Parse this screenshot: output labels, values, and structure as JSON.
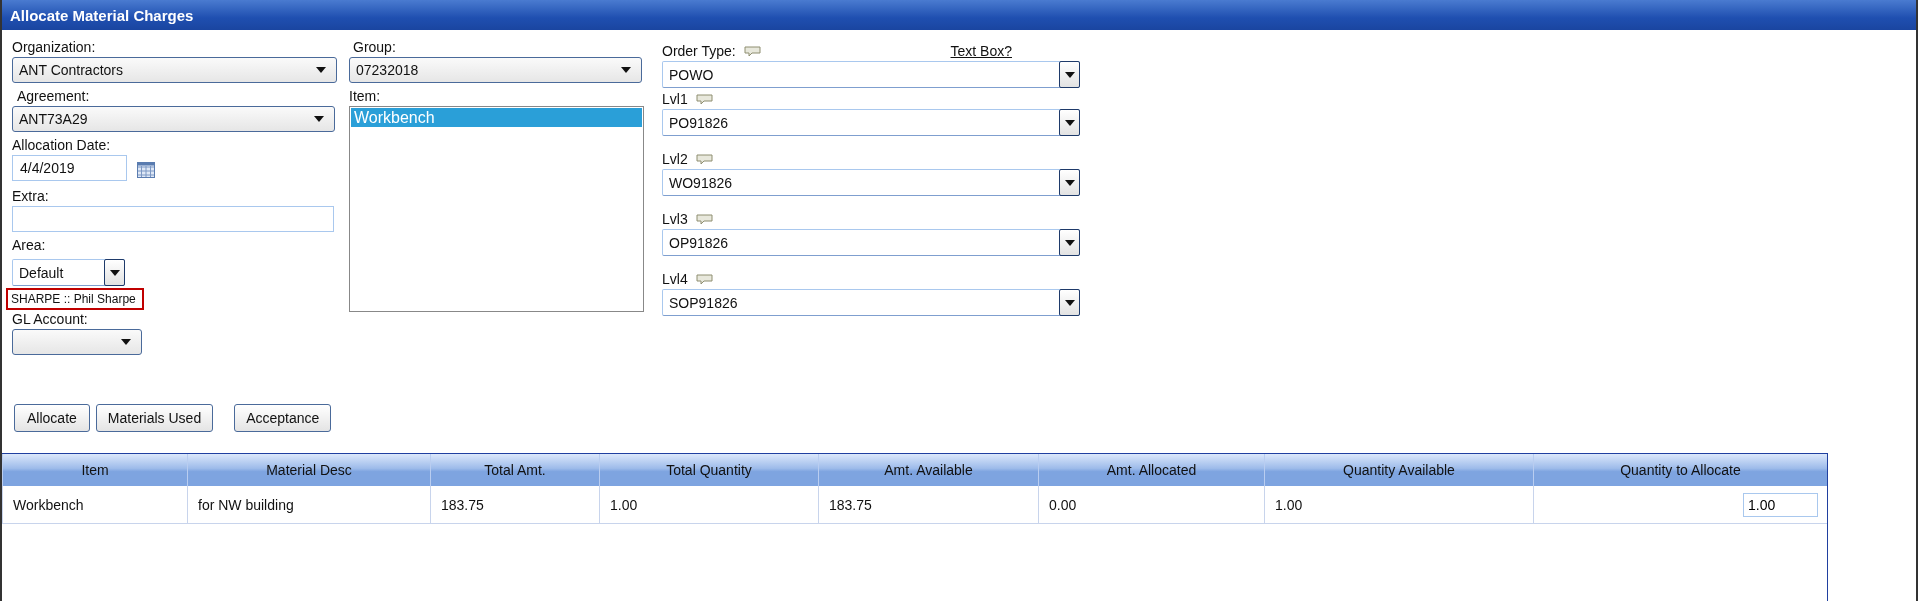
{
  "window": {
    "title": "Allocate Material Charges"
  },
  "organization": {
    "label": "Organization:",
    "value": "ANT Contractors"
  },
  "agreement": {
    "label": "Agreement:",
    "value": "ANT73A29"
  },
  "allocation_date": {
    "label": "Allocation Date:",
    "value": "4/4/2019"
  },
  "extra": {
    "label": "Extra:"
  },
  "area": {
    "label": "Area:",
    "value": "Default"
  },
  "owner_tag": "SHARPE :: Phil Sharpe",
  "gl_account": {
    "label": "GL Account:"
  },
  "group": {
    "label": "Group:",
    "value": "07232018"
  },
  "item": {
    "label": "Item:",
    "options": [
      {
        "label": "Workbench",
        "selected": true
      }
    ]
  },
  "order_type": {
    "label": "Order Type:",
    "value": "POWO"
  },
  "text_box_link": "Text Box?",
  "levels": [
    {
      "label": "Lvl1",
      "value": "PO91826"
    },
    {
      "label": "Lvl2",
      "value": "WO91826"
    },
    {
      "label": "Lvl3",
      "value": "OP91826"
    },
    {
      "label": "Lvl4",
      "value": "SOP91826"
    }
  ],
  "buttons": [
    "Allocate",
    "Materials Used",
    "Acceptance"
  ],
  "table": {
    "columns": [
      "Item",
      "Material Desc",
      "Total Amt.",
      "Total Quantity",
      "Amt. Available",
      "Amt. Allocated",
      "Quantity Available",
      "Quantity to Allocate"
    ],
    "rows": [
      {
        "cells": [
          "Workbench",
          "for NW building",
          "183.75",
          "1.00",
          "183.75",
          "0.00",
          "1.00"
        ],
        "quantity_to_allocate": "1.00"
      }
    ]
  }
}
